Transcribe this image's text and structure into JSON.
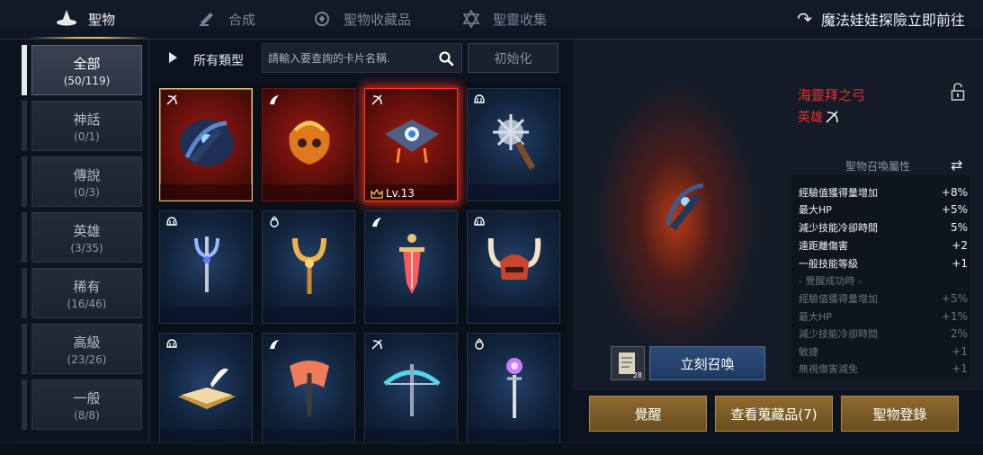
{
  "tabs": [
    {
      "label": "聖物",
      "icon": "wizard-hat-icon",
      "active": true
    },
    {
      "label": "合成",
      "icon": "anvil-icon",
      "active": false
    },
    {
      "label": "聖物收藏品",
      "icon": "collection-icon",
      "active": false
    },
    {
      "label": "聖靈收集",
      "icon": "hexagram-icon",
      "active": false
    }
  ],
  "goto_label": "魔法娃娃探險立即前往",
  "categories": [
    {
      "name": "全部",
      "count": "(50/119)",
      "active": true
    },
    {
      "name": "神話",
      "count": "(0/1)",
      "active": false
    },
    {
      "name": "傳說",
      "count": "(0/3)",
      "active": false
    },
    {
      "name": "英雄",
      "count": "(3/35)",
      "active": false
    },
    {
      "name": "稀有",
      "count": "(16/46)",
      "active": false
    },
    {
      "name": "高級",
      "count": "(23/26)",
      "active": false
    },
    {
      "name": "一般",
      "count": "(8/8)",
      "active": false
    }
  ],
  "filter": {
    "type_label": "所有類型",
    "search_placeholder": "請輸入要查詢的卡片名稱.",
    "reset_label": "初始化"
  },
  "cards": [
    {
      "type_icon": "bow-icon",
      "item": "dark-bow",
      "rarity": "red",
      "selected": true
    },
    {
      "type_icon": "wing-icon",
      "item": "flame-mask",
      "rarity": "red"
    },
    {
      "type_icon": "bow-icon",
      "item": "eye-crossbow",
      "rarity": "red",
      "glow": true,
      "level": "Lv.13"
    },
    {
      "type_icon": "helmet-icon",
      "item": "spiked-mace",
      "rarity": "blue"
    },
    {
      "type_icon": "helmet-icon",
      "item": "trident",
      "rarity": "blue"
    },
    {
      "type_icon": "ring-icon",
      "item": "horned-staff",
      "rarity": "blue"
    },
    {
      "type_icon": "wing-icon",
      "item": "ruby-sword",
      "rarity": "blue"
    },
    {
      "type_icon": "helmet-icon",
      "item": "horned-helmet",
      "rarity": "blue"
    },
    {
      "type_icon": "helmet-icon",
      "item": "spell-book",
      "rarity": "blue"
    },
    {
      "type_icon": "wing-icon",
      "item": "battle-axe",
      "rarity": "blue"
    },
    {
      "type_icon": "bow-icon",
      "item": "ice-crossbow",
      "rarity": "blue"
    },
    {
      "type_icon": "ring-icon",
      "item": "orb-wand",
      "rarity": "blue"
    }
  ],
  "detail": {
    "name": "海靈拜之弓",
    "rarity": "英雄",
    "stats_title": "聖物召喚屬性",
    "stats": [
      {
        "k": "經驗值獲得量增加",
        "v": "+8%",
        "style": "main"
      },
      {
        "k": "最大HP",
        "v": "+5%",
        "style": "main"
      },
      {
        "k": "減少技能冷卻時間",
        "v": "5%",
        "style": "main"
      },
      {
        "k": "遠距離傷害",
        "v": "+2",
        "style": "main"
      },
      {
        "k": "一般技能等級",
        "v": "+1",
        "style": "main"
      },
      {
        "k": "- 覺醒成功時 -",
        "v": "",
        "style": "note"
      },
      {
        "k": "經驗值獲得量增加",
        "v": "+5%",
        "style": "dim"
      },
      {
        "k": "最大HP",
        "v": "+1%",
        "style": "dim"
      },
      {
        "k": "減少技能冷卻時間",
        "v": "2%",
        "style": "dim"
      },
      {
        "k": "敏捷",
        "v": "+1",
        "style": "dim"
      },
      {
        "k": "無視傷害減免",
        "v": "+1",
        "style": "dim"
      }
    ],
    "summon_item_count": "28",
    "summon_label": "立刻召喚"
  },
  "actions": [
    "覺醒",
    "查看蒐藏品(7)",
    "聖物登錄"
  ],
  "colors": {
    "accent_gold": "#d6b872",
    "rarity_hero": "#e0332b",
    "summon_blue": "#2c4c78",
    "action_gold": "#7a5a26"
  }
}
